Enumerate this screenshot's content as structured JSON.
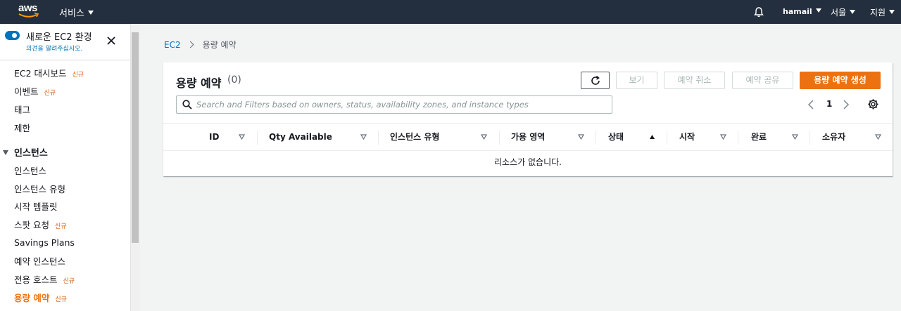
{
  "topnav": {
    "logo_text": "aws",
    "services_label": "서비스",
    "username": "hamail",
    "region": "서울",
    "support": "지원",
    "icons": [
      "bell-icon",
      "caret-down-icon"
    ]
  },
  "sidebar": {
    "new_experience_title": "새로운 EC2 환경",
    "new_experience_link": "의견을 알려주십시오.",
    "new_badge": "신규",
    "items_top": [
      {
        "label": "EC2 대시보드",
        "badge": "신규"
      },
      {
        "label": "이벤트",
        "badge": "신규"
      },
      {
        "label": "태그",
        "badge": ""
      },
      {
        "label": "제한",
        "badge": ""
      }
    ],
    "section_title": "인스턴스",
    "items_instances": [
      {
        "label": "인스턴스",
        "badge": ""
      },
      {
        "label": "인스턴스 유형",
        "badge": ""
      },
      {
        "label": "시작 템플릿",
        "badge": ""
      },
      {
        "label": "스팟 요청",
        "badge": "신규"
      },
      {
        "label": "Savings Plans",
        "badge": ""
      },
      {
        "label": "예약 인스턴스",
        "badge": ""
      },
      {
        "label": "전용 호스트",
        "badge": "신규"
      },
      {
        "label": "용량 예약",
        "badge": "신규",
        "active": true
      }
    ]
  },
  "breadcrumb": {
    "root": "EC2",
    "current": "용량 예약"
  },
  "panel": {
    "title": "용량 예약",
    "count": "(0)",
    "buttons": {
      "view": "보기",
      "cancel": "예약 취소",
      "share": "예약 공유",
      "create": "용량 예약 생성"
    },
    "search_placeholder": "Search and Filters based on owners, status, availability zones, and instance types",
    "page_number": "1",
    "columns": [
      "ID",
      "Qty Available",
      "인스턴스 유형",
      "가용 영역",
      "상태",
      "시작",
      "완료",
      "소유자"
    ],
    "sorted_column": "상태",
    "empty_message": "리소스가 없습니다."
  },
  "colors": {
    "nav_bg": "#232f3e",
    "accent_orange": "#ec7211",
    "link_blue": "#0073bb",
    "page_bg": "#f2f3f3"
  }
}
